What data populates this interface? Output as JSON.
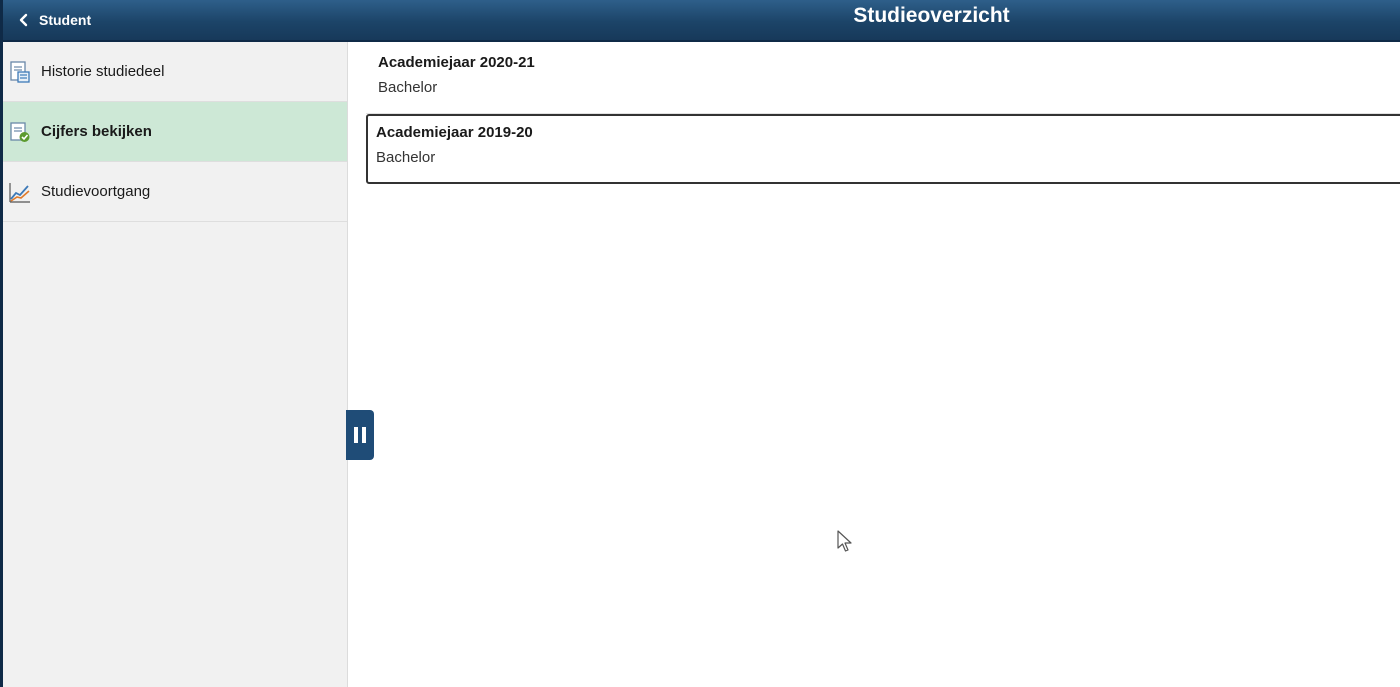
{
  "header": {
    "back_label": "Student",
    "title": "Studieoverzicht"
  },
  "sidebar": {
    "items": [
      {
        "label": "Historie studiedeel",
        "icon": "document-list-icon",
        "active": false
      },
      {
        "label": "Cijfers bekijken",
        "icon": "grades-icon",
        "active": true
      },
      {
        "label": "Studievoortgang",
        "icon": "line-chart-icon",
        "active": false
      }
    ]
  },
  "main": {
    "cards": [
      {
        "title": "Academiejaar 2020-21",
        "subtitle": "Bachelor",
        "selected": false
      },
      {
        "title": "Academiejaar 2019-20",
        "subtitle": "Bachelor",
        "selected": true
      }
    ]
  },
  "colors": {
    "header": "#1c4468",
    "active_item": "#cde8d6",
    "sidebar_bg": "#f1f1f1",
    "handle": "#1f4c77"
  }
}
